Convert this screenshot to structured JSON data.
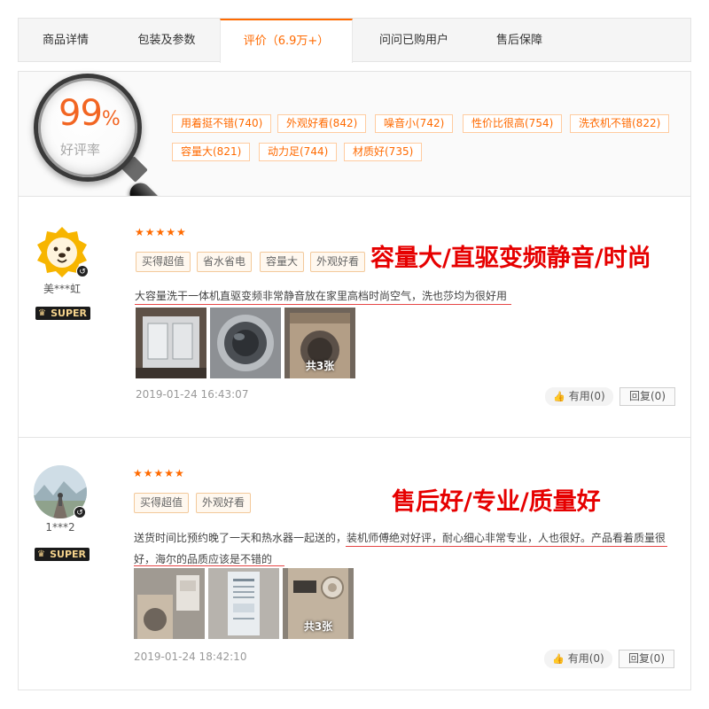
{
  "tabs": [
    {
      "label": "商品详情"
    },
    {
      "label": "包装及参数"
    },
    {
      "label": "评价（6.9万+）"
    },
    {
      "label": "问问已购用户"
    },
    {
      "label": "售后保障"
    }
  ],
  "summary": {
    "good_rate_value": "99",
    "good_rate_unit": "%",
    "good_rate_label": "好评率",
    "tags": [
      "用着挺不错(740)",
      "外观好看(842)",
      "噪音小(742)",
      "性价比很高(754)",
      "洗衣机不错(822)",
      "容量大(821)",
      "动力足(744)",
      "材质好(735)"
    ]
  },
  "reviews": [
    {
      "nickname": "美***虹",
      "badge": "SUPER",
      "stars": "★★★★★",
      "tags": [
        "买得超值",
        "省水省电",
        "容量大",
        "外观好看"
      ],
      "headline": "容量大/直驱变频静音/时尚",
      "text": "大容量洗干一体机直驱变频非常静音放在家里高档时尚空气，洗也莎均为很好用",
      "photo_count": "共3张",
      "time": "2019-01-24 16:43:07",
      "like_label": "有用(0)",
      "reply_label": "回复(0)"
    },
    {
      "nickname": "1***2",
      "badge": "SUPER",
      "stars": "★★★★★",
      "tags": [
        "买得超值",
        "外观好看"
      ],
      "headline": "售后好/专业/质量好",
      "text_line1": "送货时间比预约晚了一天和热水器一起送的，装机师傅绝对好评，耐心细心非常专业，人也很好。产品看着质量很",
      "text_line2": "好，海尔的品质应该是不错的",
      "photo_count": "共3张",
      "time": "2019-01-24 18:42:10",
      "like_label": "有用(0)",
      "reply_label": "回复(0)"
    }
  ],
  "colors": {
    "accent": "#ff6a00",
    "headline": "#e60000",
    "underline": "#e64545"
  }
}
